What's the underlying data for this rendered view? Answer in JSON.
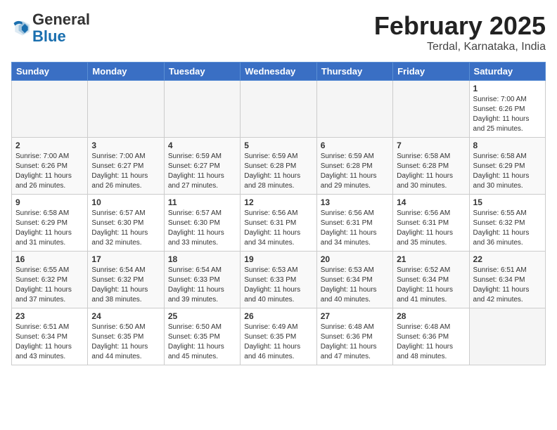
{
  "header": {
    "logo_general": "General",
    "logo_blue": "Blue",
    "month_title": "February 2025",
    "location": "Terdal, Karnataka, India"
  },
  "days_of_week": [
    "Sunday",
    "Monday",
    "Tuesday",
    "Wednesday",
    "Thursday",
    "Friday",
    "Saturday"
  ],
  "weeks": [
    [
      {
        "day": "",
        "info": ""
      },
      {
        "day": "",
        "info": ""
      },
      {
        "day": "",
        "info": ""
      },
      {
        "day": "",
        "info": ""
      },
      {
        "day": "",
        "info": ""
      },
      {
        "day": "",
        "info": ""
      },
      {
        "day": "1",
        "info": "Sunrise: 7:00 AM\nSunset: 6:26 PM\nDaylight: 11 hours\nand 25 minutes."
      }
    ],
    [
      {
        "day": "2",
        "info": "Sunrise: 7:00 AM\nSunset: 6:26 PM\nDaylight: 11 hours\nand 26 minutes."
      },
      {
        "day": "3",
        "info": "Sunrise: 7:00 AM\nSunset: 6:27 PM\nDaylight: 11 hours\nand 26 minutes."
      },
      {
        "day": "4",
        "info": "Sunrise: 6:59 AM\nSunset: 6:27 PM\nDaylight: 11 hours\nand 27 minutes."
      },
      {
        "day": "5",
        "info": "Sunrise: 6:59 AM\nSunset: 6:28 PM\nDaylight: 11 hours\nand 28 minutes."
      },
      {
        "day": "6",
        "info": "Sunrise: 6:59 AM\nSunset: 6:28 PM\nDaylight: 11 hours\nand 29 minutes."
      },
      {
        "day": "7",
        "info": "Sunrise: 6:58 AM\nSunset: 6:28 PM\nDaylight: 11 hours\nand 30 minutes."
      },
      {
        "day": "8",
        "info": "Sunrise: 6:58 AM\nSunset: 6:29 PM\nDaylight: 11 hours\nand 30 minutes."
      }
    ],
    [
      {
        "day": "9",
        "info": "Sunrise: 6:58 AM\nSunset: 6:29 PM\nDaylight: 11 hours\nand 31 minutes."
      },
      {
        "day": "10",
        "info": "Sunrise: 6:57 AM\nSunset: 6:30 PM\nDaylight: 11 hours\nand 32 minutes."
      },
      {
        "day": "11",
        "info": "Sunrise: 6:57 AM\nSunset: 6:30 PM\nDaylight: 11 hours\nand 33 minutes."
      },
      {
        "day": "12",
        "info": "Sunrise: 6:56 AM\nSunset: 6:31 PM\nDaylight: 11 hours\nand 34 minutes."
      },
      {
        "day": "13",
        "info": "Sunrise: 6:56 AM\nSunset: 6:31 PM\nDaylight: 11 hours\nand 34 minutes."
      },
      {
        "day": "14",
        "info": "Sunrise: 6:56 AM\nSunset: 6:31 PM\nDaylight: 11 hours\nand 35 minutes."
      },
      {
        "day": "15",
        "info": "Sunrise: 6:55 AM\nSunset: 6:32 PM\nDaylight: 11 hours\nand 36 minutes."
      }
    ],
    [
      {
        "day": "16",
        "info": "Sunrise: 6:55 AM\nSunset: 6:32 PM\nDaylight: 11 hours\nand 37 minutes."
      },
      {
        "day": "17",
        "info": "Sunrise: 6:54 AM\nSunset: 6:32 PM\nDaylight: 11 hours\nand 38 minutes."
      },
      {
        "day": "18",
        "info": "Sunrise: 6:54 AM\nSunset: 6:33 PM\nDaylight: 11 hours\nand 39 minutes."
      },
      {
        "day": "19",
        "info": "Sunrise: 6:53 AM\nSunset: 6:33 PM\nDaylight: 11 hours\nand 40 minutes."
      },
      {
        "day": "20",
        "info": "Sunrise: 6:53 AM\nSunset: 6:34 PM\nDaylight: 11 hours\nand 40 minutes."
      },
      {
        "day": "21",
        "info": "Sunrise: 6:52 AM\nSunset: 6:34 PM\nDaylight: 11 hours\nand 41 minutes."
      },
      {
        "day": "22",
        "info": "Sunrise: 6:51 AM\nSunset: 6:34 PM\nDaylight: 11 hours\nand 42 minutes."
      }
    ],
    [
      {
        "day": "23",
        "info": "Sunrise: 6:51 AM\nSunset: 6:34 PM\nDaylight: 11 hours\nand 43 minutes."
      },
      {
        "day": "24",
        "info": "Sunrise: 6:50 AM\nSunset: 6:35 PM\nDaylight: 11 hours\nand 44 minutes."
      },
      {
        "day": "25",
        "info": "Sunrise: 6:50 AM\nSunset: 6:35 PM\nDaylight: 11 hours\nand 45 minutes."
      },
      {
        "day": "26",
        "info": "Sunrise: 6:49 AM\nSunset: 6:35 PM\nDaylight: 11 hours\nand 46 minutes."
      },
      {
        "day": "27",
        "info": "Sunrise: 6:48 AM\nSunset: 6:36 PM\nDaylight: 11 hours\nand 47 minutes."
      },
      {
        "day": "28",
        "info": "Sunrise: 6:48 AM\nSunset: 6:36 PM\nDaylight: 11 hours\nand 48 minutes."
      },
      {
        "day": "",
        "info": ""
      }
    ]
  ]
}
